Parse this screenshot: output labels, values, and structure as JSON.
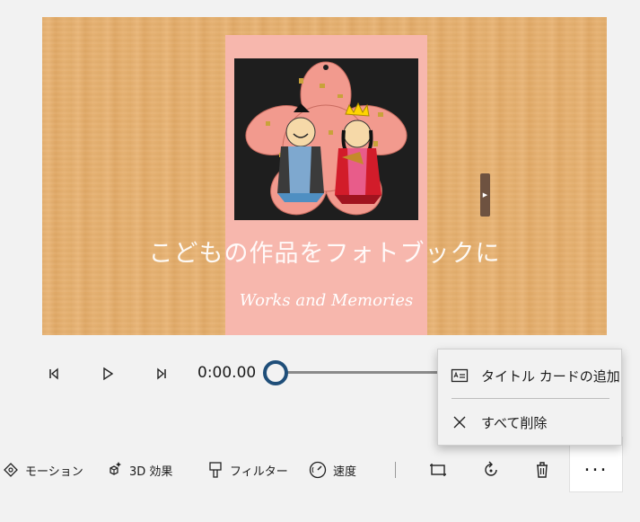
{
  "preview": {
    "caption": "こどもの作品をフォトブックに",
    "book_subtitle": "Works and Memories"
  },
  "playback": {
    "time": "0:00.00",
    "progress": 0.0
  },
  "context_menu": {
    "items": [
      {
        "label": "タイトル カードの追加",
        "icon": "title-card-icon"
      },
      {
        "label": "すべて削除",
        "icon": "close-icon"
      }
    ]
  },
  "toolbar": {
    "motion": "モーション",
    "effects_3d": "3D 効果",
    "filters": "フィルター",
    "speed": "速度",
    "more": "..."
  },
  "colors": {
    "accent": "#1f4e79",
    "book": "#f7b7ad",
    "wood": "#e3ae6e"
  }
}
